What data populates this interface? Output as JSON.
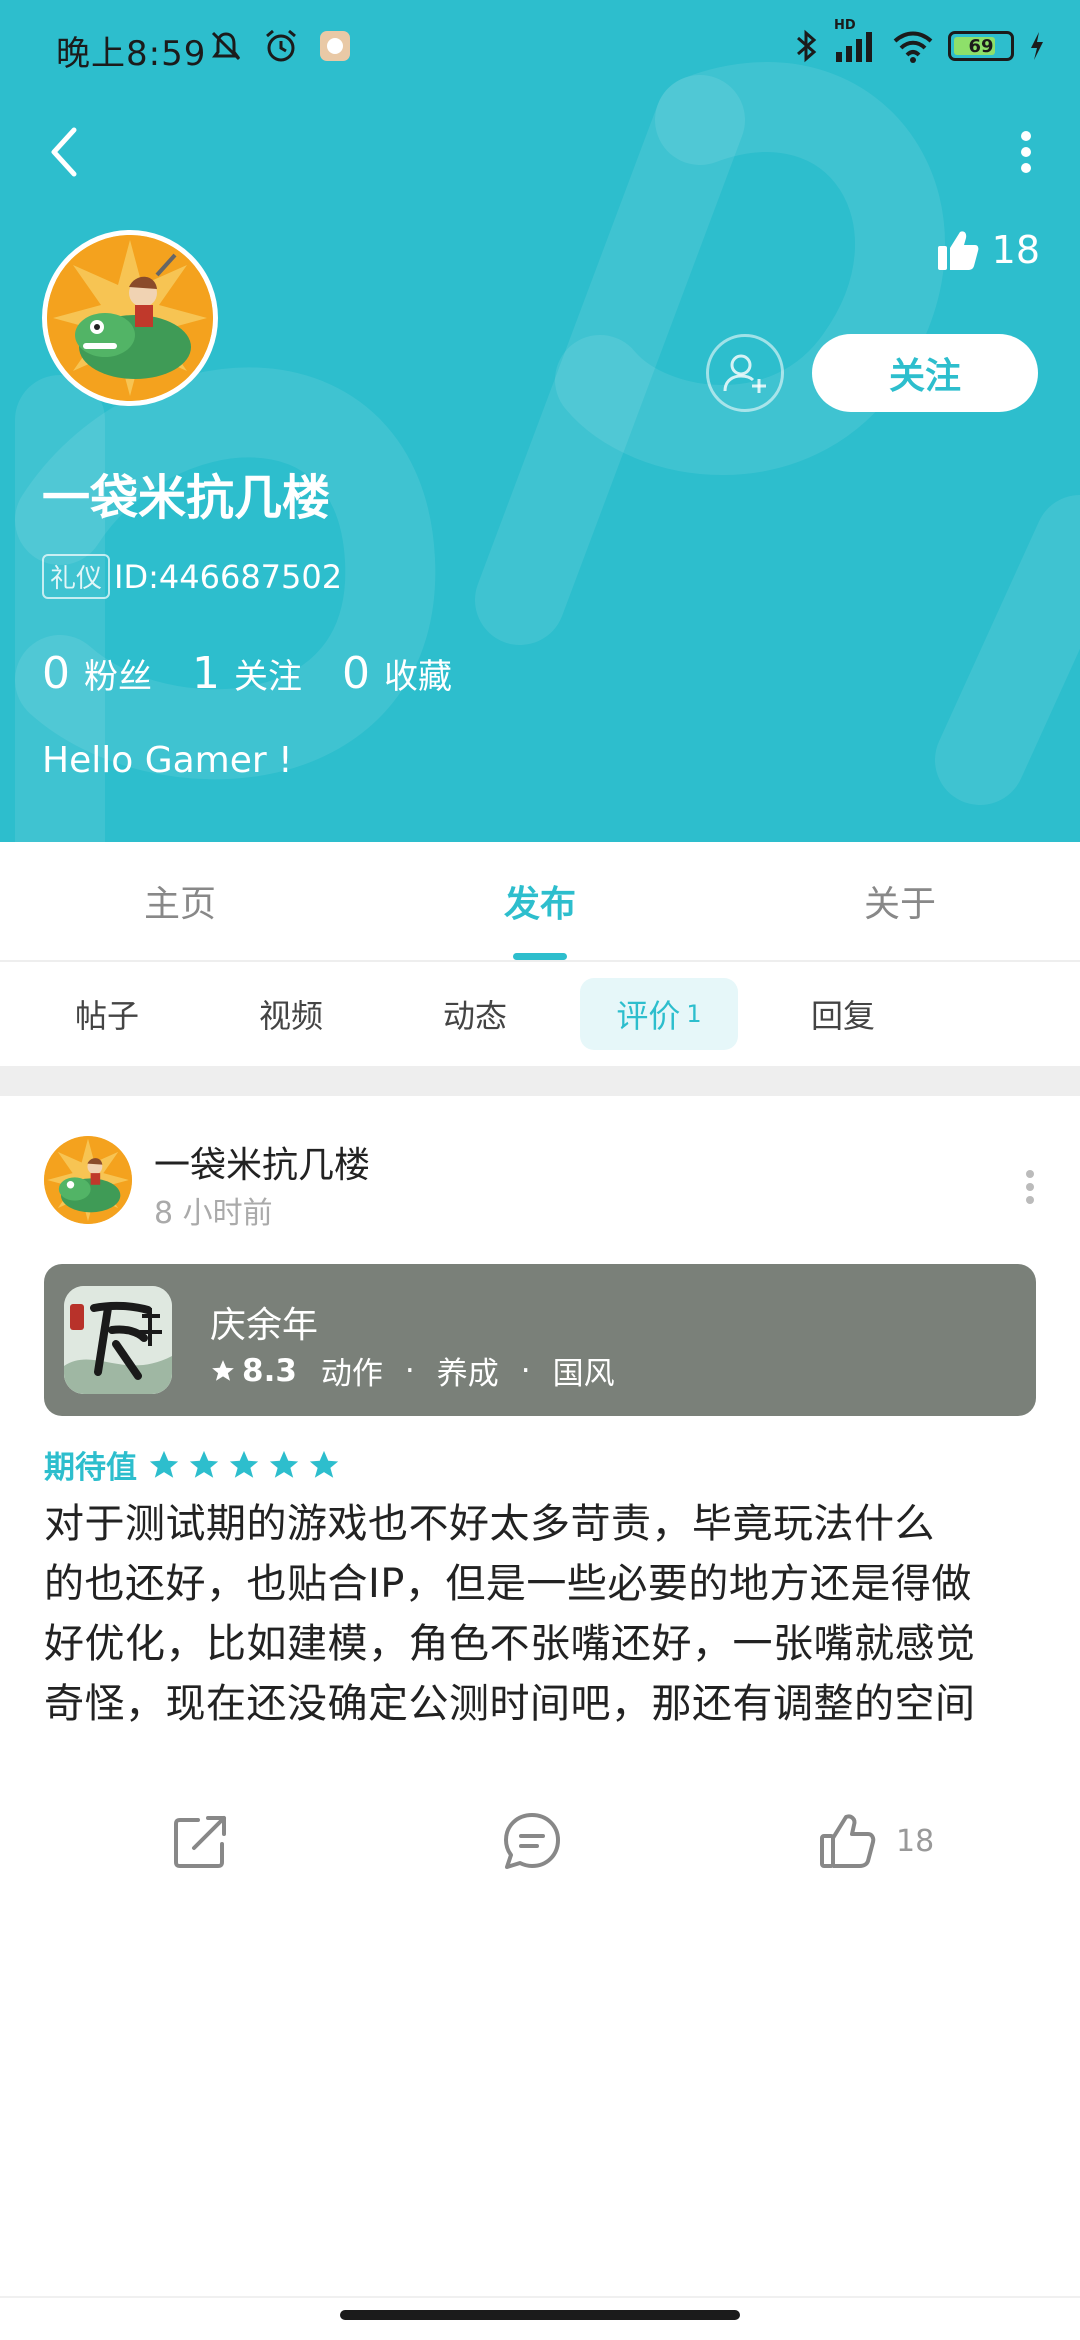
{
  "status_bar": {
    "time": "晚上8:59",
    "battery": "69",
    "network": "HD"
  },
  "header": {
    "like_count": "18",
    "follow_label": "关注",
    "username": "一袋米抗几楼",
    "badge": "礼仪",
    "user_id": "ID:446687502",
    "stats": [
      {
        "num": "0",
        "label": "粉丝"
      },
      {
        "num": "1",
        "label": "关注"
      },
      {
        "num": "0",
        "label": "收藏"
      }
    ],
    "bio": "Hello Gamer !"
  },
  "main_tabs": [
    {
      "label": "主页",
      "active": false
    },
    {
      "label": "发布",
      "active": true
    },
    {
      "label": "关于",
      "active": false
    }
  ],
  "sub_tabs": [
    {
      "label": "帖子",
      "count": ""
    },
    {
      "label": "视频",
      "count": ""
    },
    {
      "label": "动态",
      "count": ""
    },
    {
      "label": "评价",
      "count": "1"
    },
    {
      "label": "回复",
      "count": ""
    }
  ],
  "post": {
    "author": "一袋米抗几楼",
    "time": "8 小时前",
    "game": {
      "name": "庆余年",
      "score": "8.3",
      "tags": [
        "动作",
        "养成",
        "国风"
      ]
    },
    "rating_label": "期待值",
    "rating_stars": 5,
    "text_lines": [
      "对于测试期的游戏也不好太多苛责，毕竟玩法什么",
      "的也还好，也贴合IP，但是一些必要的地方还是得做",
      "好优化，比如建模，角色不张嘴还好，一张嘴就感觉",
      "奇怪，现在还没确定公测时间吧，那还有调整的空间"
    ],
    "like_count": "18"
  },
  "colors": {
    "brand": "#2dbecd",
    "game_card": "#7a8079"
  }
}
